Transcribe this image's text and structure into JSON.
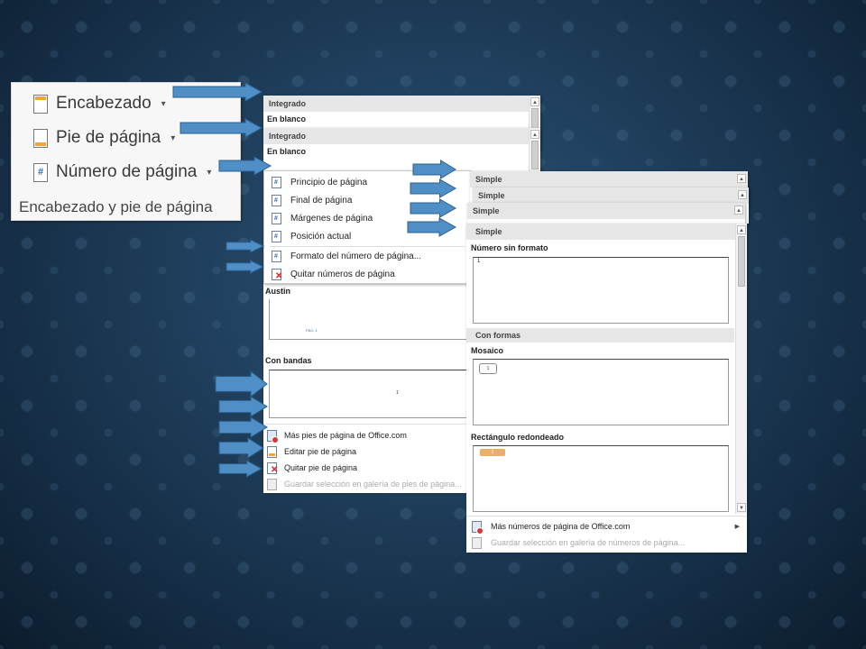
{
  "ribbon": {
    "items": [
      {
        "label": "Encabezado",
        "icon": "header-page-icon"
      },
      {
        "label": "Pie de página",
        "icon": "footer-page-icon"
      },
      {
        "label": "Número de página",
        "icon": "page-number-icon"
      }
    ],
    "group_label": "Encabezado y pie de página"
  },
  "header_gallery": {
    "section": "Integrado",
    "item": "En blanco"
  },
  "footer_gallery": {
    "section": "Integrado",
    "item": "En blanco",
    "austin": "Austin",
    "austin_preview_text": "PÁG. 1",
    "bands": "Con bandas",
    "bands_preview_text": "1",
    "footer_actions": [
      {
        "label": "Más pies de página de Office.com",
        "icon": "office-web-icon"
      },
      {
        "label": "Editar pie de página",
        "icon": "edit-footer-icon"
      },
      {
        "label": "Quitar pie de página",
        "icon": "remove-footer-icon"
      },
      {
        "label": "Guardar selección en galería de pies de página...",
        "icon": "save-gallery-icon",
        "disabled": true
      }
    ]
  },
  "page_number_menu": {
    "items": [
      {
        "label": "Principio de página"
      },
      {
        "label": "Final de página"
      },
      {
        "label": "Márgenes de página"
      },
      {
        "label": "Posición actual"
      },
      {
        "label": "Formato del número de página..."
      },
      {
        "label": "Quitar números de página"
      }
    ]
  },
  "submenus": {
    "headers": [
      "Simple",
      "Simple",
      "Simple",
      "Simple"
    ]
  },
  "number_gallery": {
    "plain": "Número sin formato",
    "plain_value": "1",
    "shapes_section": "Con formas",
    "mosaic": "Mosaico",
    "mosaic_value": "1",
    "rounded": "Rectángulo redondeado",
    "rounded_value": "1",
    "actions": [
      {
        "label": "Más números de página de Office.com",
        "icon": "office-web-icon"
      },
      {
        "label": "Guardar selección en galería de números de página...",
        "icon": "save-gallery-icon",
        "disabled": true
      }
    ]
  },
  "colors": {
    "arrow_fill": "#4f8fc6",
    "arrow_stroke": "#2a5f8f",
    "background": "#1f3f5c",
    "accent_orange": "#f0a43a"
  }
}
